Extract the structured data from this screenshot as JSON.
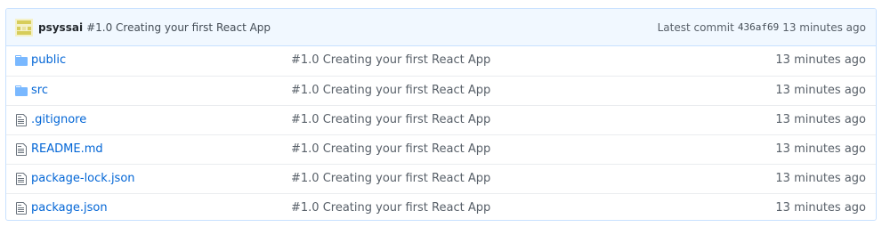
{
  "commit": {
    "author": "psyssai",
    "message": "#1.0 Creating your first React App",
    "latest_label": "Latest commit",
    "sha": "436af69",
    "age": "13 minutes ago"
  },
  "files": [
    {
      "name": "public",
      "type": "folder",
      "message": "#1.0 Creating your first React App",
      "age": "13 minutes ago"
    },
    {
      "name": "src",
      "type": "folder",
      "message": "#1.0 Creating your first React App",
      "age": "13 minutes ago"
    },
    {
      "name": ".gitignore",
      "type": "file",
      "message": "#1.0 Creating your first React App",
      "age": "13 minutes ago"
    },
    {
      "name": "README.md",
      "type": "file",
      "message": "#1.0 Creating your first React App",
      "age": "13 minutes ago"
    },
    {
      "name": "package-lock.json",
      "type": "file",
      "message": "#1.0 Creating your first React App",
      "age": "13 minutes ago"
    },
    {
      "name": "package.json",
      "type": "file",
      "message": "#1.0 Creating your first React App",
      "age": "13 minutes ago"
    }
  ],
  "colors": {
    "link": "#0366d6",
    "folder_icon": "#79b8ff",
    "file_icon": "#6a737d",
    "header_bg": "#f1f8ff"
  }
}
